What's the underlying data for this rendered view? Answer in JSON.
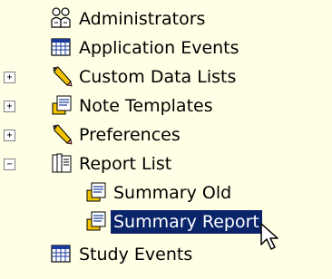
{
  "tree": {
    "items": [
      {
        "label": "Administrators",
        "icon": "users-group-icon",
        "expander": ""
      },
      {
        "label": "Application Events",
        "icon": "calendar-table-icon",
        "expander": ""
      },
      {
        "label": "Custom Data Lists",
        "icon": "pencil-icon",
        "expander": "+"
      },
      {
        "label": "Note Templates",
        "icon": "clipboard-note-icon",
        "expander": "+"
      },
      {
        "label": "Preferences",
        "icon": "pencil-icon",
        "expander": "+"
      },
      {
        "label": "Report List",
        "icon": "report-books-icon",
        "expander": "−"
      },
      {
        "label": "Summary Old",
        "icon": "clipboard-note-icon",
        "expander": ""
      },
      {
        "label": "Summary Report",
        "icon": "clipboard-note-icon",
        "expander": "",
        "selected": true
      },
      {
        "label": "Study Events",
        "icon": "calendar-table-icon",
        "expander": ""
      }
    ]
  },
  "colors": {
    "background": "#FFFFE6",
    "selection": "#0A246A",
    "selection_text": "#FFFFFF"
  }
}
